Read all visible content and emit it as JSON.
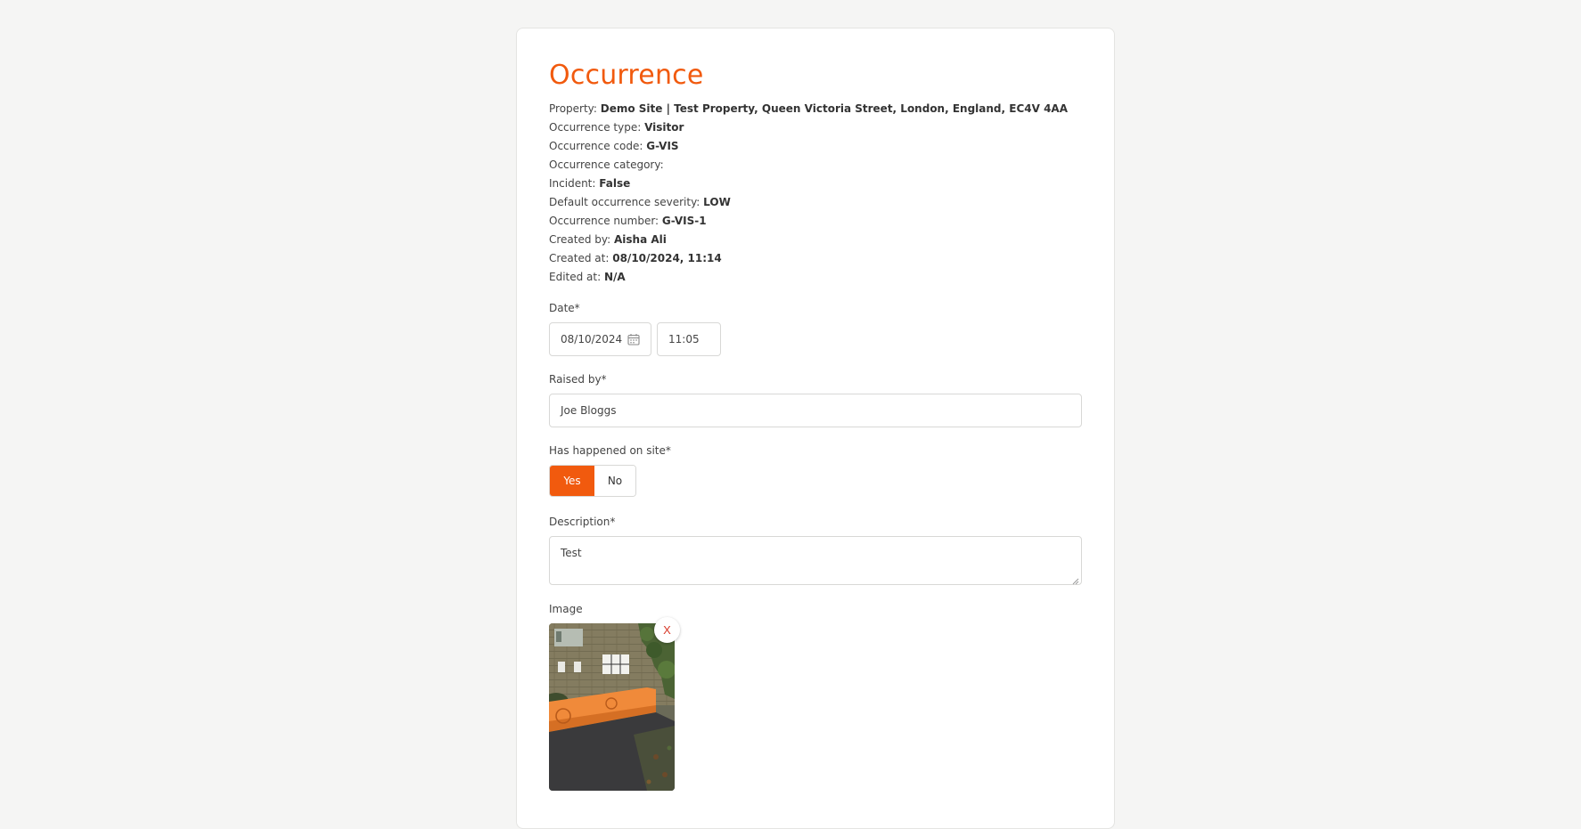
{
  "page": {
    "title": "Occurrence"
  },
  "meta": [
    {
      "label": "Property: ",
      "value": "Demo Site | Test Property, Queen Victoria Street, London, England, EC4V 4AA"
    },
    {
      "label": "Occurrence type: ",
      "value": "Visitor"
    },
    {
      "label": "Occurrence code: ",
      "value": "G-VIS"
    },
    {
      "label": "Occurrence category: ",
      "value": ""
    },
    {
      "label": "Incident: ",
      "value": "False"
    },
    {
      "label": "Default occurrence severity: ",
      "value": "LOW"
    },
    {
      "label": "Occurrence number: ",
      "value": "G-VIS-1"
    },
    {
      "label": "Created by: ",
      "value": "Aisha Ali"
    },
    {
      "label": "Created at: ",
      "value": "08/10/2024, 11:14"
    },
    {
      "label": "Edited at: ",
      "value": "N/A"
    }
  ],
  "form": {
    "date": {
      "label": "Date*",
      "date_value": "08/10/2024",
      "time_value": "11:05",
      "icon": "calendar-icon"
    },
    "raised_by": {
      "label": "Raised by*",
      "value": "Joe Bloggs"
    },
    "on_site": {
      "label": "Has happened on site*",
      "yes_label": "Yes",
      "no_label": "No",
      "selected": "Yes"
    },
    "description": {
      "label": "Description*",
      "value": "Test"
    },
    "image": {
      "label": "Image",
      "remove_label": "X"
    }
  },
  "colors": {
    "accent": "#f15a0e",
    "remove": "#d83a2a",
    "background": "#f5f5f4"
  }
}
